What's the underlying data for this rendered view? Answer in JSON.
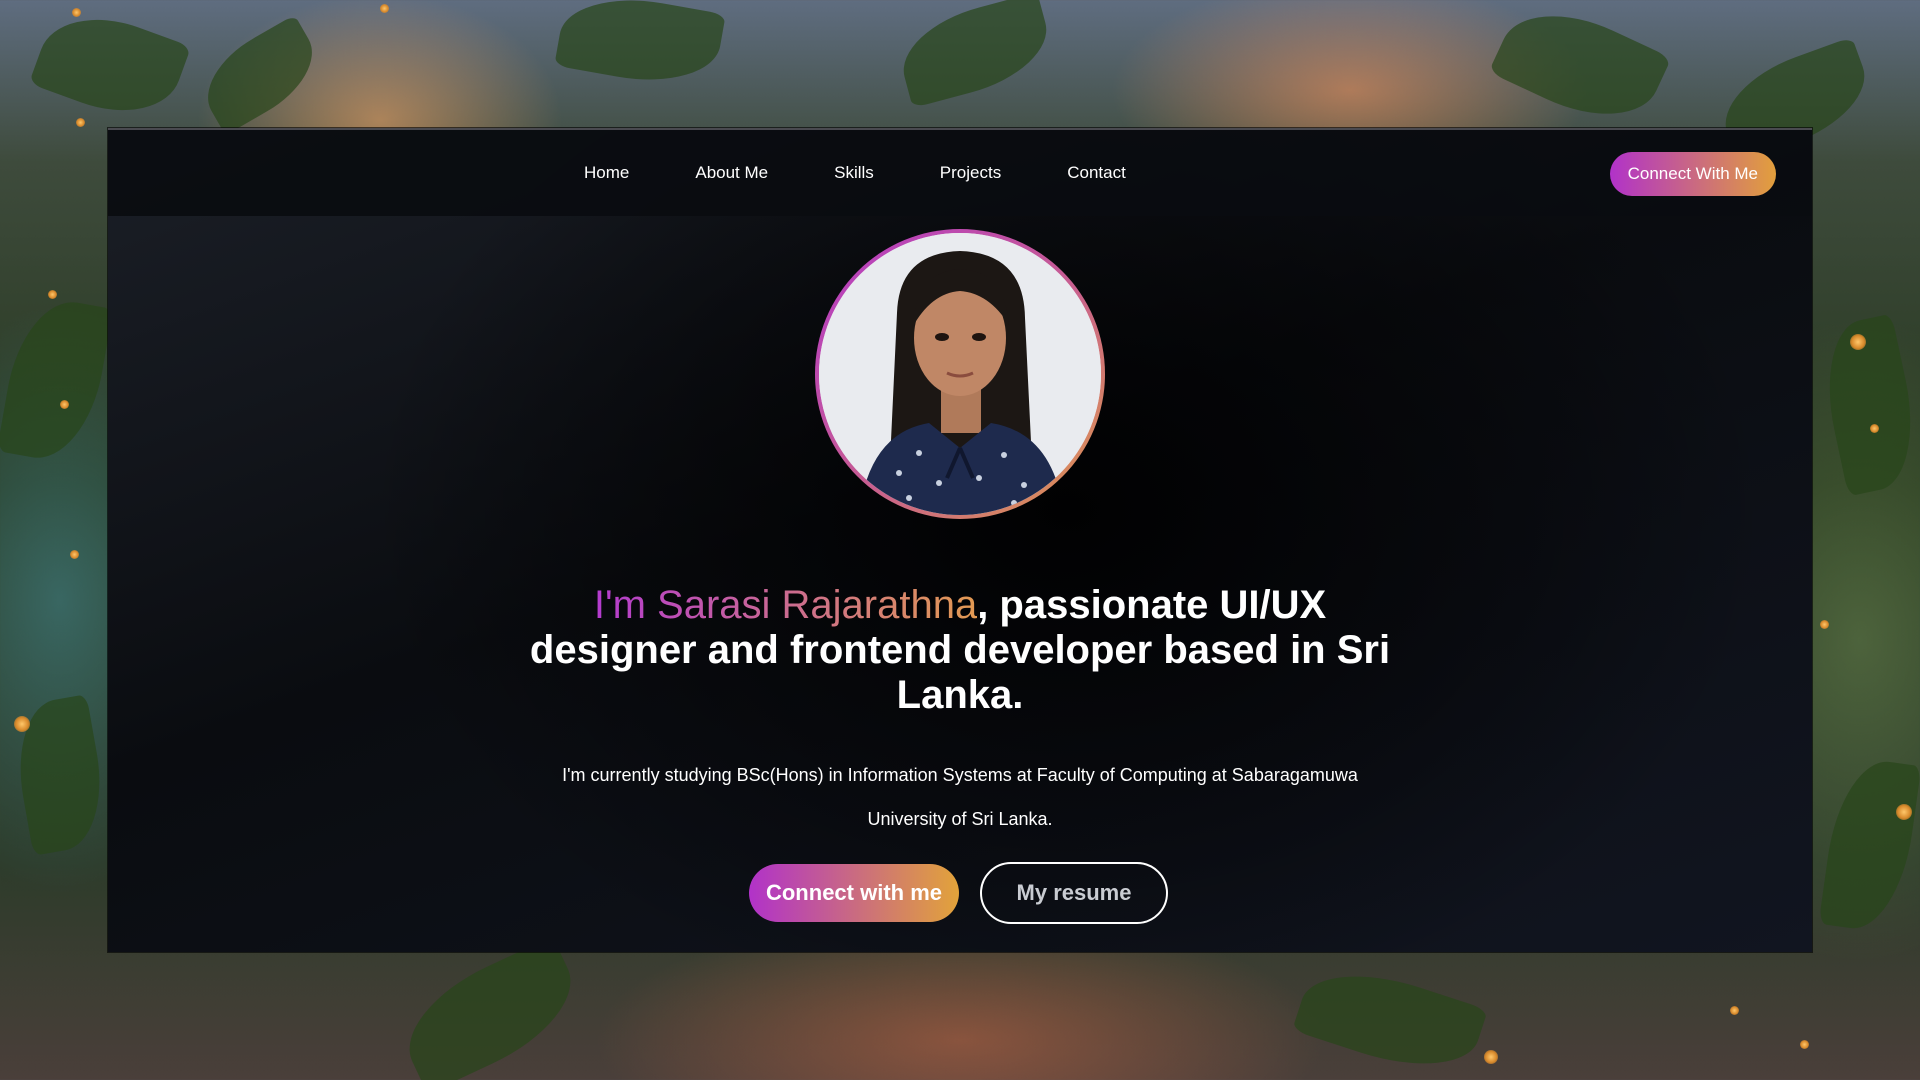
{
  "nav": {
    "links": [
      "Home",
      "About Me",
      "Skills",
      "Projects",
      "Contact"
    ],
    "cta_label": "Connect With Me"
  },
  "hero": {
    "avatar_alt": "profile-photo",
    "headline_name": "I'm Sarasi Rajarathna",
    "headline_rest": ", passionate UI/UX designer and frontend developer based in Sri Lanka.",
    "subtext": "I'm currently studying BSc(Hons) in Information Systems at Faculty of Computing at Sabaragamuwa University of Sri Lanka.",
    "primary_button": "Connect with me",
    "secondary_button": "My resume"
  },
  "colors": {
    "accent_start": "#b132c9",
    "accent_end": "#e2a33a",
    "panel_bg": "#0a0c10",
    "text": "#ffffff"
  }
}
